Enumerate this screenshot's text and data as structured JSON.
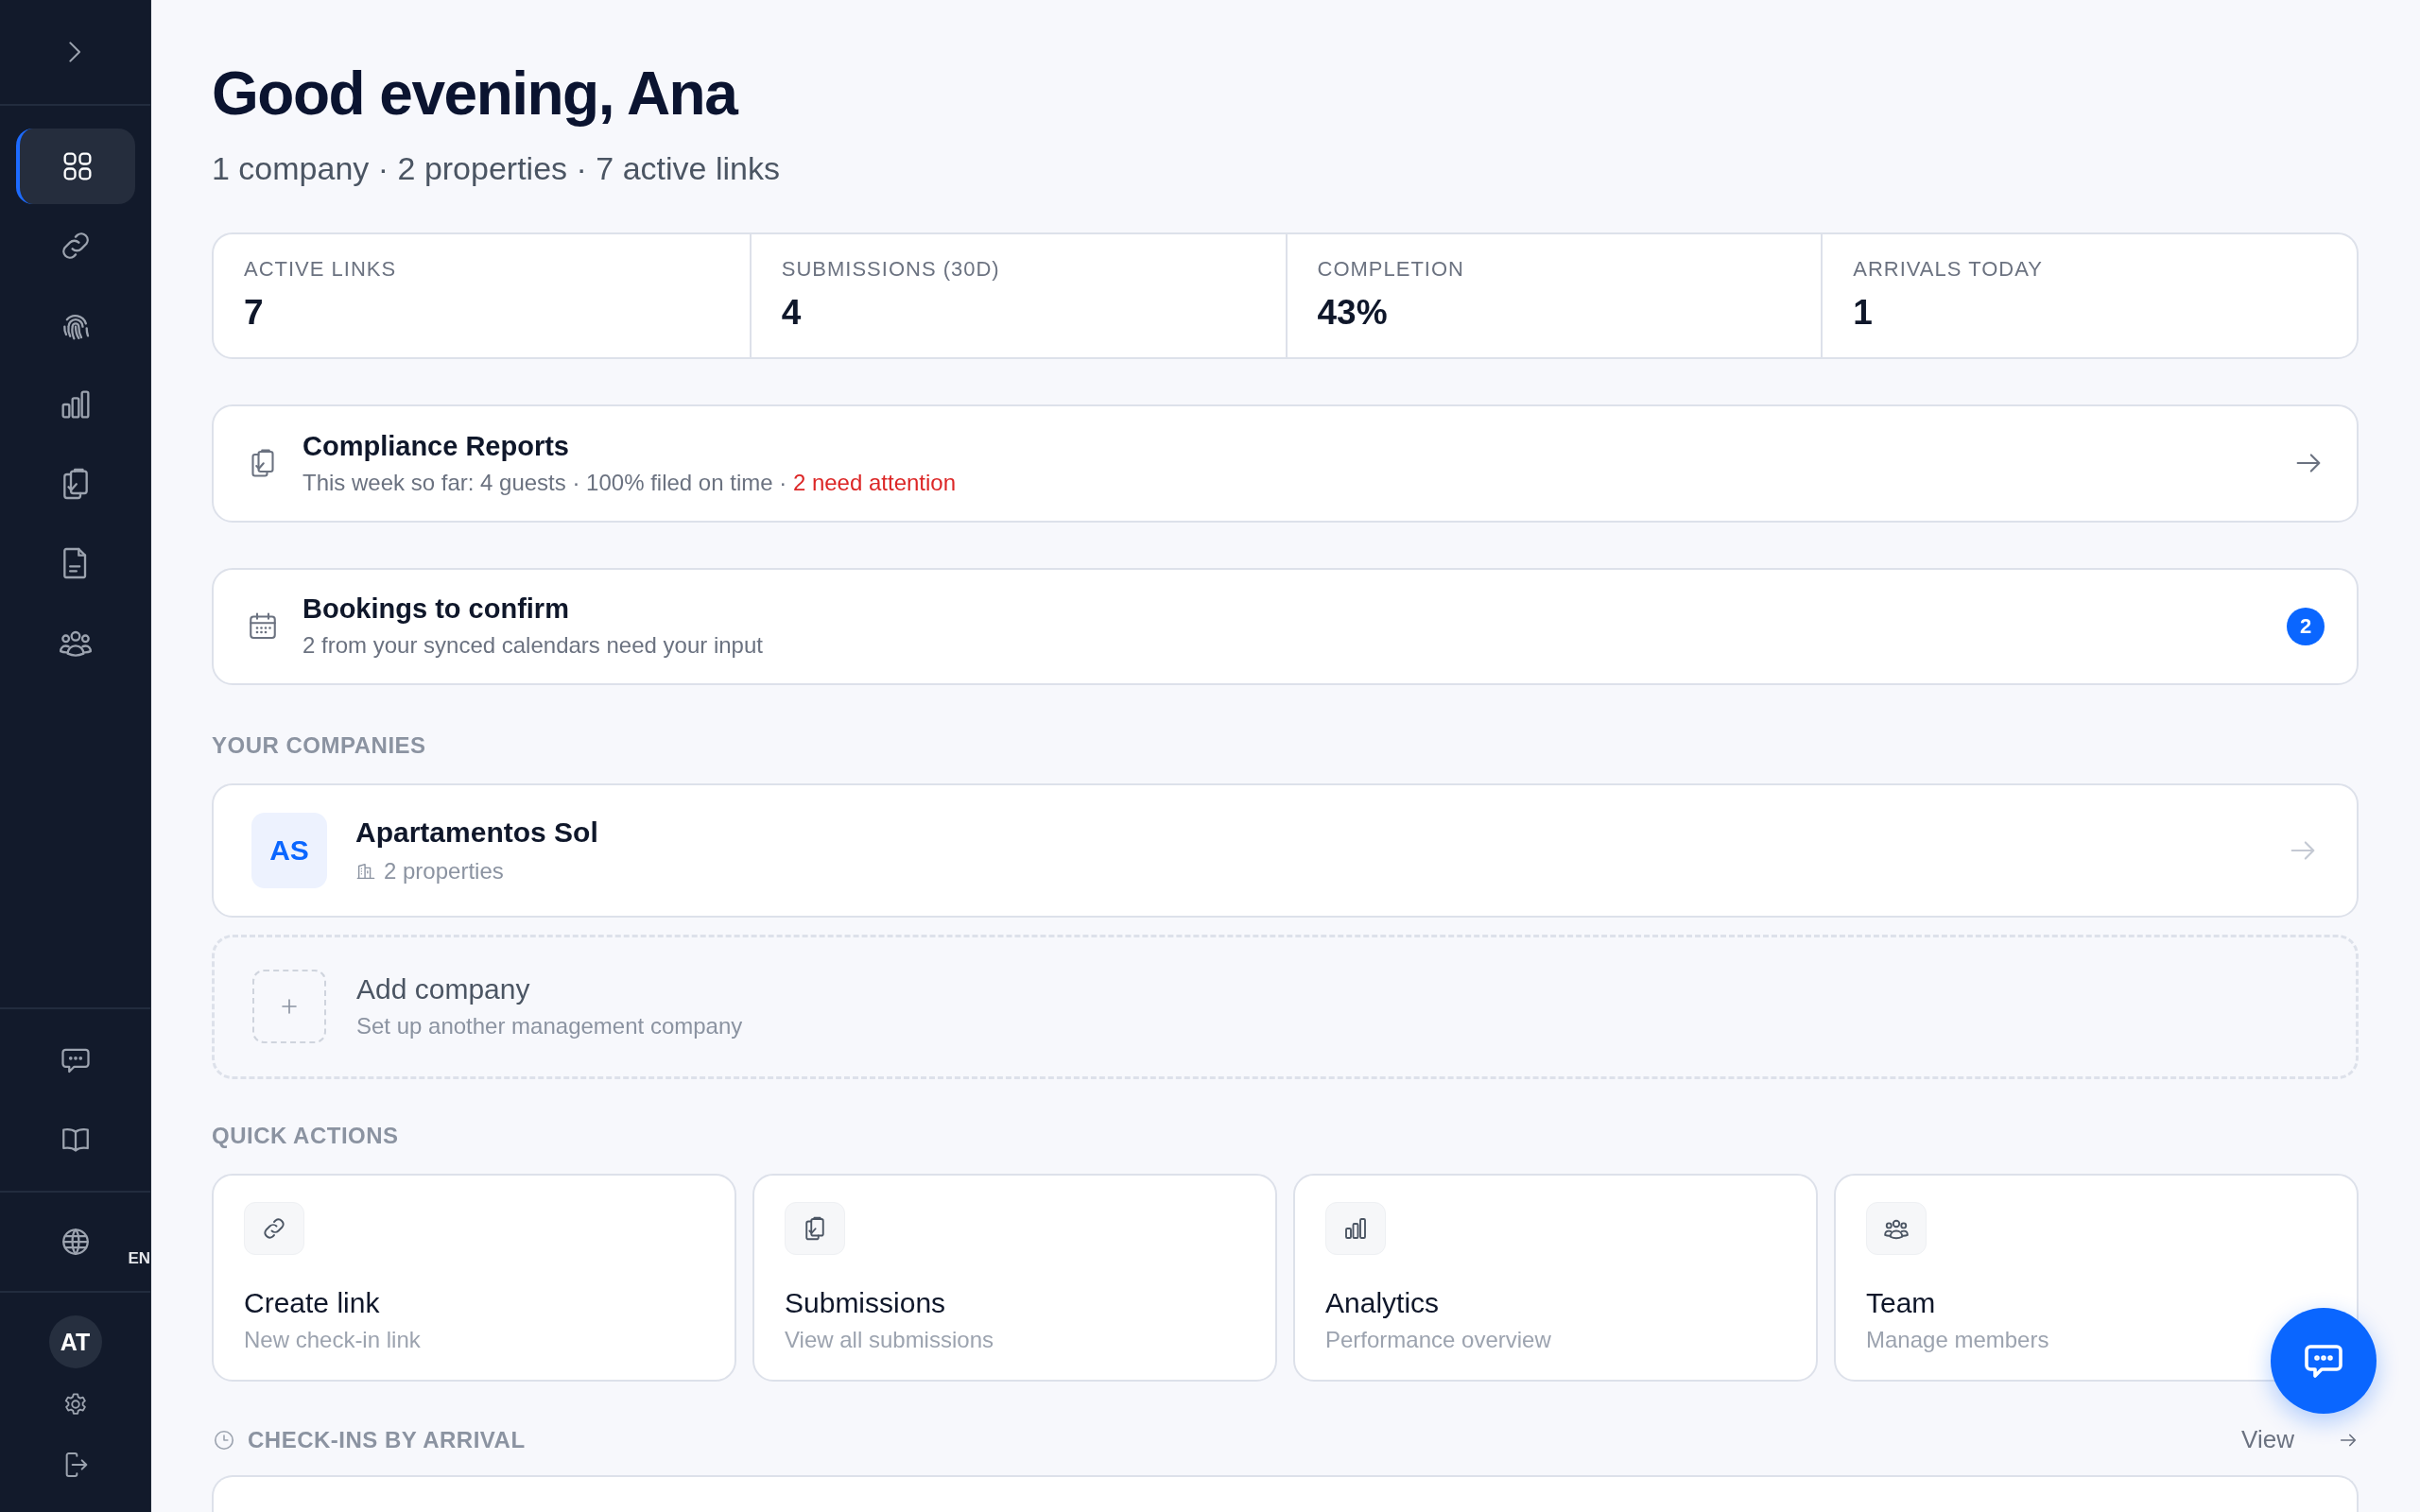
{
  "sidebar": {
    "nav": [
      {
        "kind": "grid",
        "selected": true
      },
      {
        "kind": "link",
        "selected": false
      },
      {
        "kind": "fingerprint",
        "selected": false
      },
      {
        "kind": "chart",
        "selected": false
      },
      {
        "kind": "clipboard",
        "selected": false
      },
      {
        "kind": "file",
        "selected": false
      },
      {
        "kind": "users",
        "selected": false
      }
    ],
    "language": "EN",
    "avatar": "AT"
  },
  "header": {
    "greeting": "Good evening, Ana",
    "summary": "1 company · 2 properties · 7 active links"
  },
  "stats": [
    {
      "label": "ACTIVE LINKS",
      "value": "7"
    },
    {
      "label": "SUBMISSIONS (30D)",
      "value": "4"
    },
    {
      "label": "COMPLETION",
      "value": "43%"
    },
    {
      "label": "ARRIVALS TODAY",
      "value": "1"
    }
  ],
  "notices": [
    {
      "kind": "compliance",
      "title": "Compliance Reports",
      "subtitle": "This week so far: 4 guests · 100% filed on time · ",
      "alert": "2 need attention"
    },
    {
      "kind": "bookings",
      "title": "Bookings to confirm",
      "subtitle": "2 from your synced calendars need your input",
      "badge": "2"
    }
  ],
  "companies": {
    "title": "YOUR COMPANIES",
    "items": [
      {
        "initials": "AS",
        "name": "Apartamentos Sol",
        "properties": "2 properties"
      }
    ],
    "add": {
      "title": "Add company",
      "subtitle": "Set up another management company"
    }
  },
  "quick_actions": {
    "title": "QUICK ACTIONS",
    "items": [
      {
        "kind": "link",
        "title": "Create link",
        "subtitle": "New check-in link"
      },
      {
        "kind": "clipboard",
        "title": "Submissions",
        "subtitle": "View all submissions"
      },
      {
        "kind": "chart",
        "title": "Analytics",
        "subtitle": "Performance overview"
      },
      {
        "kind": "users",
        "title": "Team",
        "subtitle": "Manage members"
      }
    ]
  },
  "checkins": {
    "title": "CHECK-INS BY ARRIVAL",
    "link": "View"
  }
}
